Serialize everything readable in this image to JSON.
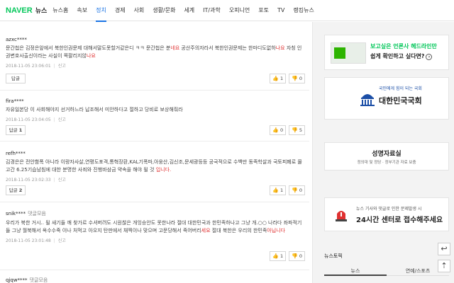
{
  "nav": {
    "logo": "NAVER",
    "section": "뉴스",
    "items": [
      "뉴스홈",
      "속보",
      "정치",
      "경제",
      "사회",
      "생활/문화",
      "세계",
      "IT/과학",
      "오피니언",
      "포토",
      "TV",
      "랭킹뉴스"
    ],
    "active_index": 2
  },
  "comments": [
    {
      "user": "azxc****",
      "text_a": "문간첩은 김정은앞에서 북한인권문제 대해서말도못할거같은디 ㅋㅋ 문간첩은 분",
      "text_red1": "네요",
      "text_b": " 공산주의자라서 북한인권문제는 한마디도없하",
      "text_red2": "나요",
      "text_c": " 자칭 인권변호사출신이라는 사실이 쪽팔리지않",
      "text_red3": "나요",
      "time": "2018-11-05 23:06:01",
      "report": "신고",
      "reply_label": "답글",
      "reply_count": "",
      "likes": "1",
      "dislikes": "0"
    },
    {
      "user": "fira****",
      "text": "자유일본당 이 사회해야지 선거하느라 납조해서 미안하다고 절하고 당비로 보상해줘라",
      "time": "2018-11-05 23:04:05",
      "report": "신고",
      "reply_label": "답글",
      "reply_count": "1",
      "likes": "0",
      "dislikes": "5"
    },
    {
      "user": "refh****",
      "text_a": "김경은은 전안함폭 아니라 이랑자사살,연평도포격,통혁장환,KAL기폭파,아웅산,김신조,문세광등등 공국적으로 수백만 동족학살과 국토피폐로 몰고간 6.25기습남침에 대한 분명한 사죄와 진행바삼금 약속을 해야 될 것",
      "text_red": "입니다.",
      "time": "2018-11-05 23:02:33",
      "report": "신고",
      "reply_label": "답글",
      "reply_count": "2",
      "likes": "1",
      "dislikes": "0"
    },
    {
      "user": "snik****",
      "user_tag": "댓글모음",
      "text_a": "우리가 북한 거시.. 될 새기들 깨 찾가르 수셔버려도 시원찮은 개잉승안도 못한나라 절대 대한민국과 한민족하나고 그냥 개.○○ 나라다 좌파적기들 그냥 월북해서 옥수수죽 이나 처먹고 아오지 탄판에서 채찍이나 맞으며 고문당해서 죽어버리",
      "text_red1": "세요",
      "text_b": " 절대 북한은 우리의 한민족",
      "text_red2": "아닙니다",
      "time": "2018-11-05 23:01:48",
      "report": "신고",
      "likes": "1",
      "dislikes": "0"
    },
    {
      "user": "qjqw****",
      "user_tag": "댓글모음"
    }
  ],
  "sidebar": {
    "ad1_line1": "보고싶은 언론사 헤드라인만",
    "ad1_line2": "쉽게 확인하고 싶다면?",
    "ad1_arrow": "›",
    "ad2_small": "국민에게 힘이 되는 국회",
    "ad2_big": "대한민국국회",
    "ad3_title": "성명자료실",
    "ad3_sub": "정의대 및 정당 · 정부기관 자료 보충",
    "ad4_small": "뉴스 기사와 댓글로 인한 문제발생 시",
    "ad4_big": "24시간 센터로 접수해주세요",
    "news_top_label": "뉴스토픽",
    "tabs": [
      "뉴스",
      "연예/스포츠"
    ],
    "colors": {
      "accent": "#03c75a",
      "link": "#1b74e4",
      "highlight": "#e03131"
    }
  },
  "floating": {
    "back": "↩",
    "top": "⇡"
  }
}
